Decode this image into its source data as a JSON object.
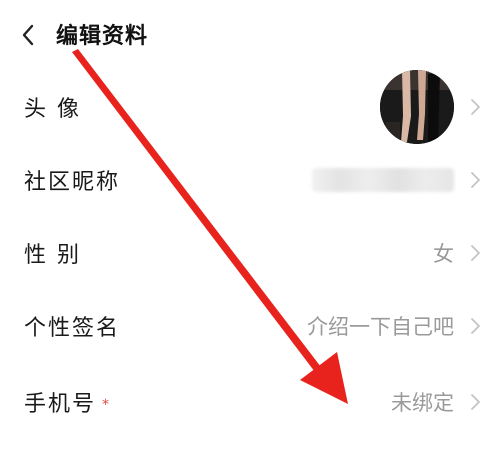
{
  "header": {
    "title": "编辑资料",
    "back_icon": "chevron-left-icon"
  },
  "rows": [
    {
      "label": "头 像",
      "kind": "avatar"
    },
    {
      "label": "社区昵称",
      "kind": "blurred"
    },
    {
      "label": "性 别",
      "value": "女"
    },
    {
      "label": "个性签名",
      "value": "介绍一下自己吧"
    },
    {
      "label": "手机号",
      "required_mark": "*",
      "value": "未绑定"
    }
  ],
  "colors": {
    "annotation_arrow": "#e8231d",
    "required_mark": "#e0493b",
    "value_text": "#9a9a9a",
    "chevron": "#c4c4c4"
  },
  "icons": {
    "row_chevron": "chevron-right-icon"
  }
}
